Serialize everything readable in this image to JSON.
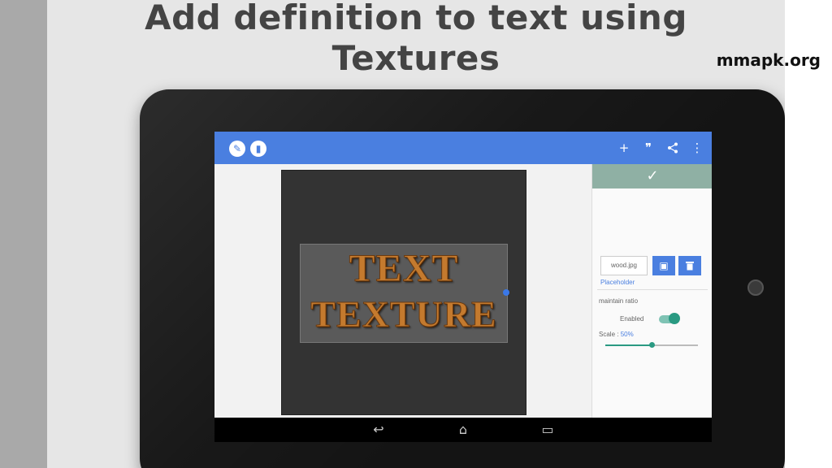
{
  "headline": {
    "line1": "Add definition to text using",
    "line2": "Textures"
  },
  "watermark": "mmapk.org",
  "app": {
    "toolbar": {
      "left_icons": [
        "pencil-icon",
        "trash-icon"
      ],
      "right_icons": [
        "add-icon",
        "quote-icon",
        "share-icon",
        "overflow-menu-icon"
      ]
    },
    "canvas": {
      "text_line1": "TEXT",
      "text_line2": "TEXTURE"
    },
    "panel": {
      "confirm_glyph": "✓",
      "texture_file": "wood.jpg",
      "link_label": "Placeholder",
      "section_label": "maintain ratio",
      "enabled_label": "Enabled",
      "enabled_state": true,
      "scale_label": "Scale :",
      "scale_value": "50%",
      "scale_fraction": 0.5
    },
    "nav": [
      "back-icon",
      "home-icon",
      "recents-icon"
    ]
  },
  "colors": {
    "app_bar": "#4a7fe0",
    "accent_teal": "#2a9a82",
    "confirm_bar": "#8fb0a4",
    "texture_text": "#c47a2e"
  }
}
